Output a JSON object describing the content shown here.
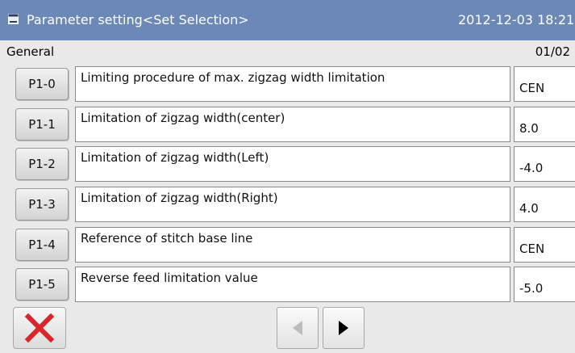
{
  "header": {
    "title": "Parameter setting<Set Selection>",
    "datetime": "2012-12-03  18:21",
    "icon": "screen-icon"
  },
  "section": {
    "label": "General",
    "page": "01/02"
  },
  "parameters": [
    {
      "code": "P1-0",
      "description": "Limiting procedure of max. zigzag width limitation",
      "value": "CEN"
    },
    {
      "code": "P1-1",
      "description": "Limitation of zigzag width(center)",
      "value": "8.0"
    },
    {
      "code": "P1-2",
      "description": "Limitation of zigzag width(Left)",
      "value": "-4.0"
    },
    {
      "code": "P1-3",
      "description": "Limitation of zigzag width(Right)",
      "value": "4.0"
    },
    {
      "code": "P1-4",
      "description": "Reference of stitch base line",
      "value": "CEN"
    },
    {
      "code": "P1-5",
      "description": "Reverse feed limitation value",
      "value": "-5.0"
    }
  ],
  "footer": {
    "close_icon": "close-x-icon",
    "prev_icon": "arrow-left-icon",
    "next_icon": "arrow-right-icon"
  },
  "colors": {
    "titlebar": "#6b88b6",
    "close": "#d8262c",
    "prev_disabled": "#bcbcbc",
    "next_enabled": "#000000"
  }
}
